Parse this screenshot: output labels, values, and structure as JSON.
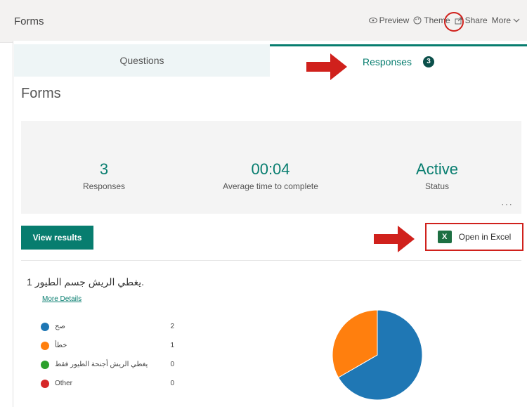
{
  "header": {
    "app_title": "Forms",
    "actions": [
      "Preview",
      "Theme",
      "Share",
      "More"
    ]
  },
  "tabs": {
    "questions": "Questions",
    "responses": "Responses",
    "responses_count": "3"
  },
  "form": {
    "title": "Forms"
  },
  "summary": {
    "responses": {
      "value": "3",
      "label": "Responses"
    },
    "avg_time": {
      "value": "00:04",
      "label": "Average time to complete"
    },
    "status": {
      "value": "Active",
      "label": "Status"
    }
  },
  "actions": {
    "view_results": "View results",
    "open_excel": "Open in Excel"
  },
  "question": {
    "number": "1.",
    "title": "يغطي الريش جسم الطيور",
    "more_details": "More Details",
    "options": [
      {
        "label": "صح",
        "count": "2",
        "color": "#1f77b4"
      },
      {
        "label": "خطأ",
        "count": "1",
        "color": "#ff7f0e"
      },
      {
        "label": "يغطي الريش أجنحة الطيور فقط",
        "count": "0",
        "color": "#2ca02c"
      },
      {
        "label": "Other",
        "count": "0",
        "color": "#d62728"
      }
    ]
  },
  "colors": {
    "accent": "#077d6f",
    "annotation": "#d0211c"
  }
}
